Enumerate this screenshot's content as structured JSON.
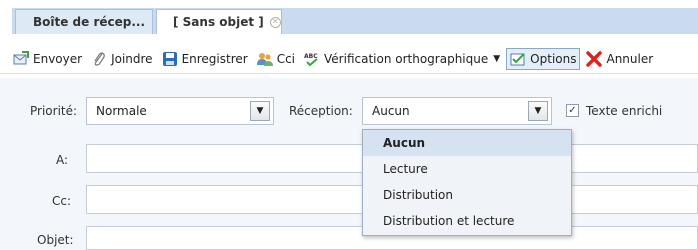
{
  "tabs": [
    {
      "label": "Boîte de récep..."
    },
    {
      "label": "[ Sans objet ]"
    }
  ],
  "toolbar": {
    "send": "Envoyer",
    "attach": "Joindre",
    "save": "Enregistrer",
    "bcc": "Cci",
    "spellcheck": "Vérification orthographique",
    "options": "Options",
    "cancel": "Annuler"
  },
  "form": {
    "priority_label": "Priorité:",
    "priority_value": "Normale",
    "receipt_label": "Réception:",
    "receipt_value": "Aucun",
    "rich_text_label": "Texte enrichi",
    "rich_text_checked": true,
    "to_label": "A:",
    "cc_label": "Cc:",
    "subject_label": "Objet:"
  },
  "receipt_options": [
    "Aucun",
    "Lecture",
    "Distribution",
    "Distribution et lecture"
  ],
  "receipt_selected": "Aucun",
  "colors": {
    "tab_bar": "#c9dcef",
    "form_background": "#f3f6fa",
    "selected_option": "#d4e2f1",
    "cancel_icon": "#d9261c",
    "save_icon": "#2b6cb3"
  },
  "icons": [
    "send-mail-icon",
    "paperclip-icon",
    "floppy-disk-icon",
    "contacts-icon",
    "abc-spellcheck-icon",
    "options-checkbox-icon",
    "red-x-icon",
    "tab-close-icon"
  ]
}
